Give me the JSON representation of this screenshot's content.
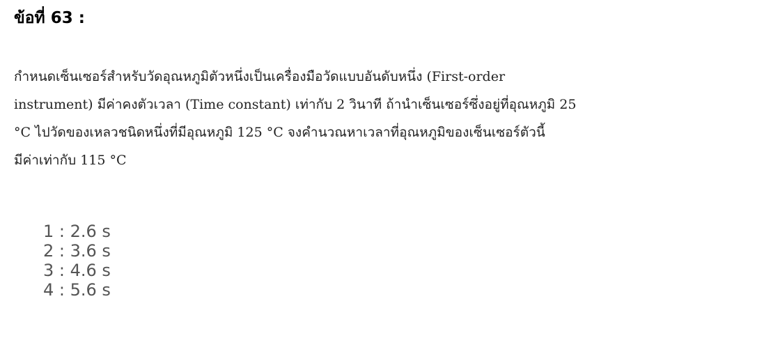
{
  "question": {
    "title": "ข้อที่ 63 :",
    "lines": [
      "กำหนดเซ็นเซอร์สำหรับวัดอุณหภูมิตัวหนึ่งเป็นเครื่องมือวัดแบบอันดับหนึ่ง (First-order",
      "instrument) มีค่าคงตัวเวลา (Time constant) เท่ากับ 2 วินาที ถ้านำเซ็นเซอร์ซึ่งอยู่ที่อุณหภูมิ 25",
      "°C ไปวัดของเหลวชนิดหนึ่งที่มีอุณหภูมิ 125 °C จงคำนวณหาเวลาที่อุณหภูมิของเซ็นเซอร์ตัวนี้",
      "มีค่าเท่ากับ 115 °C"
    ]
  },
  "choices": [
    "1 : 2.6 s",
    "2 : 3.6 s",
    "3 : 4.6 s",
    "4 : 5.6 s"
  ]
}
